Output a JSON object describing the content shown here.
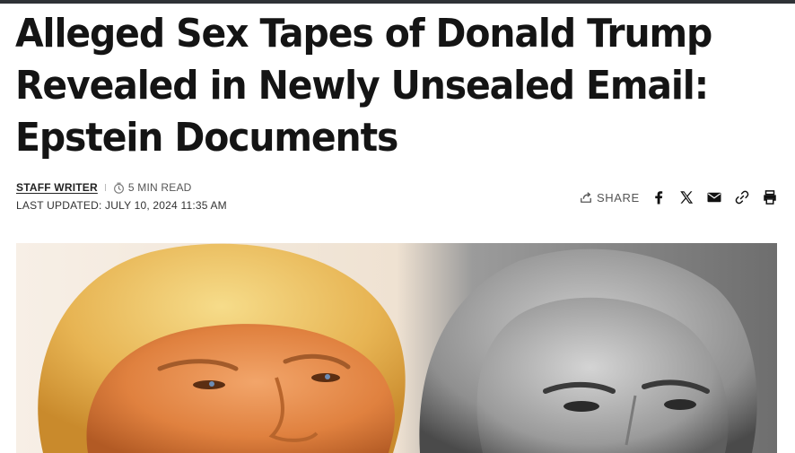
{
  "article": {
    "headline": "Alleged Sex Tapes of Donald Trump Revealed in Newly Unsealed Email: Epstein Documents",
    "author": "STAFF WRITER",
    "read_time": "5 MIN READ",
    "last_updated": "LAST UPDATED: JULY 10, 2024 11:35 AM"
  },
  "share": {
    "label": "SHARE",
    "buttons": [
      "facebook-icon",
      "x-twitter-icon",
      "email-icon",
      "link-icon",
      "print-icon"
    ]
  },
  "icons": {
    "read_time": "clock-icon",
    "share": "share-arrow-icon"
  },
  "colors": {
    "top_bar": "#2f3236",
    "headline": "#141414",
    "meta_text": "#333333",
    "icons": "#111111"
  }
}
